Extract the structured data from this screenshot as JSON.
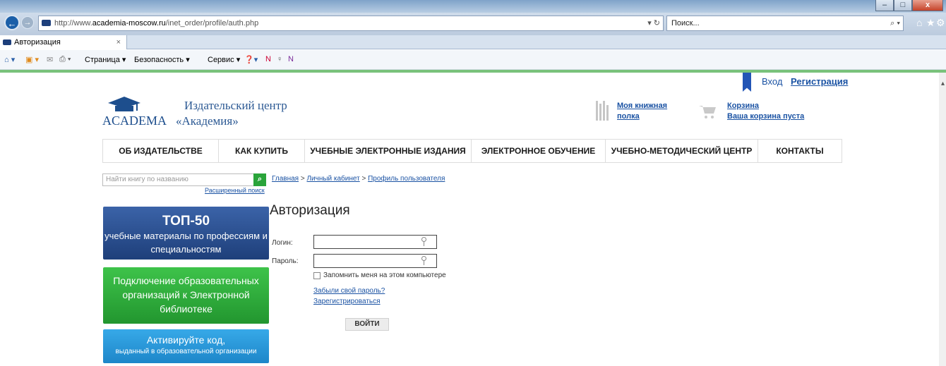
{
  "browser": {
    "url_prefix": "http://www.",
    "url_domain": "academia-moscow.ru",
    "url_path": "/inet_order/profile/auth.php",
    "search_placeholder": "Поиск...",
    "tab_title": "Авторизация",
    "commands": {
      "page": "Страница ▾",
      "security": "Безопасность ▾",
      "service": "Сервис ▾"
    }
  },
  "header": {
    "login": "Вход",
    "register": "Регистрация",
    "logo_word": "ACADEMA",
    "logo_name_1": "Издательский центр",
    "logo_name_2": "«Академия»",
    "shelf": "Моя книжная полка",
    "cart_title": "Корзина",
    "cart_status": "Ваша корзина пуста"
  },
  "menu": [
    "ОБ ИЗДАТЕЛЬСТВЕ",
    "КАК КУПИТЬ",
    "УЧЕБНЫЕ ЭЛЕКТРОННЫЕ ИЗДАНИЯ",
    "ЭЛЕКТРОННОЕ ОБУЧЕНИЕ",
    "УЧЕБНО-МЕТОДИЧЕСКИЙ ЦЕНТР",
    "КОНТАКТЫ"
  ],
  "search": {
    "placeholder": "Найти книгу по названию",
    "advanced": "Расширенный поиск"
  },
  "breadcrumbs": [
    "Главная",
    "Личный кабинет",
    "Профиль пользователя"
  ],
  "promos": {
    "top": {
      "title": "ТОП-50",
      "subtitle": "учебные материалы по профессиям и специальностям"
    },
    "connect": "Подключение образовательных организаций к Электронной библиотеке",
    "activate": {
      "title": "Активируйте код,",
      "subtitle": "выданный в образовательной организации"
    }
  },
  "auth": {
    "title": "Авторизация",
    "login_label": "Логин:",
    "password_label": "Пароль:",
    "remember": "Запомнить меня на этом компьютере",
    "forgot": "Забыли свой пароль?",
    "register": "Зарегистрироваться",
    "submit": "ВОЙТИ"
  },
  "colors": {
    "link": "#1a52a3",
    "accent_green": "#79c27b",
    "promo_blue": "#1e3f7a",
    "promo_green": "#22962f",
    "promo_lightblue": "#1d86c9"
  }
}
